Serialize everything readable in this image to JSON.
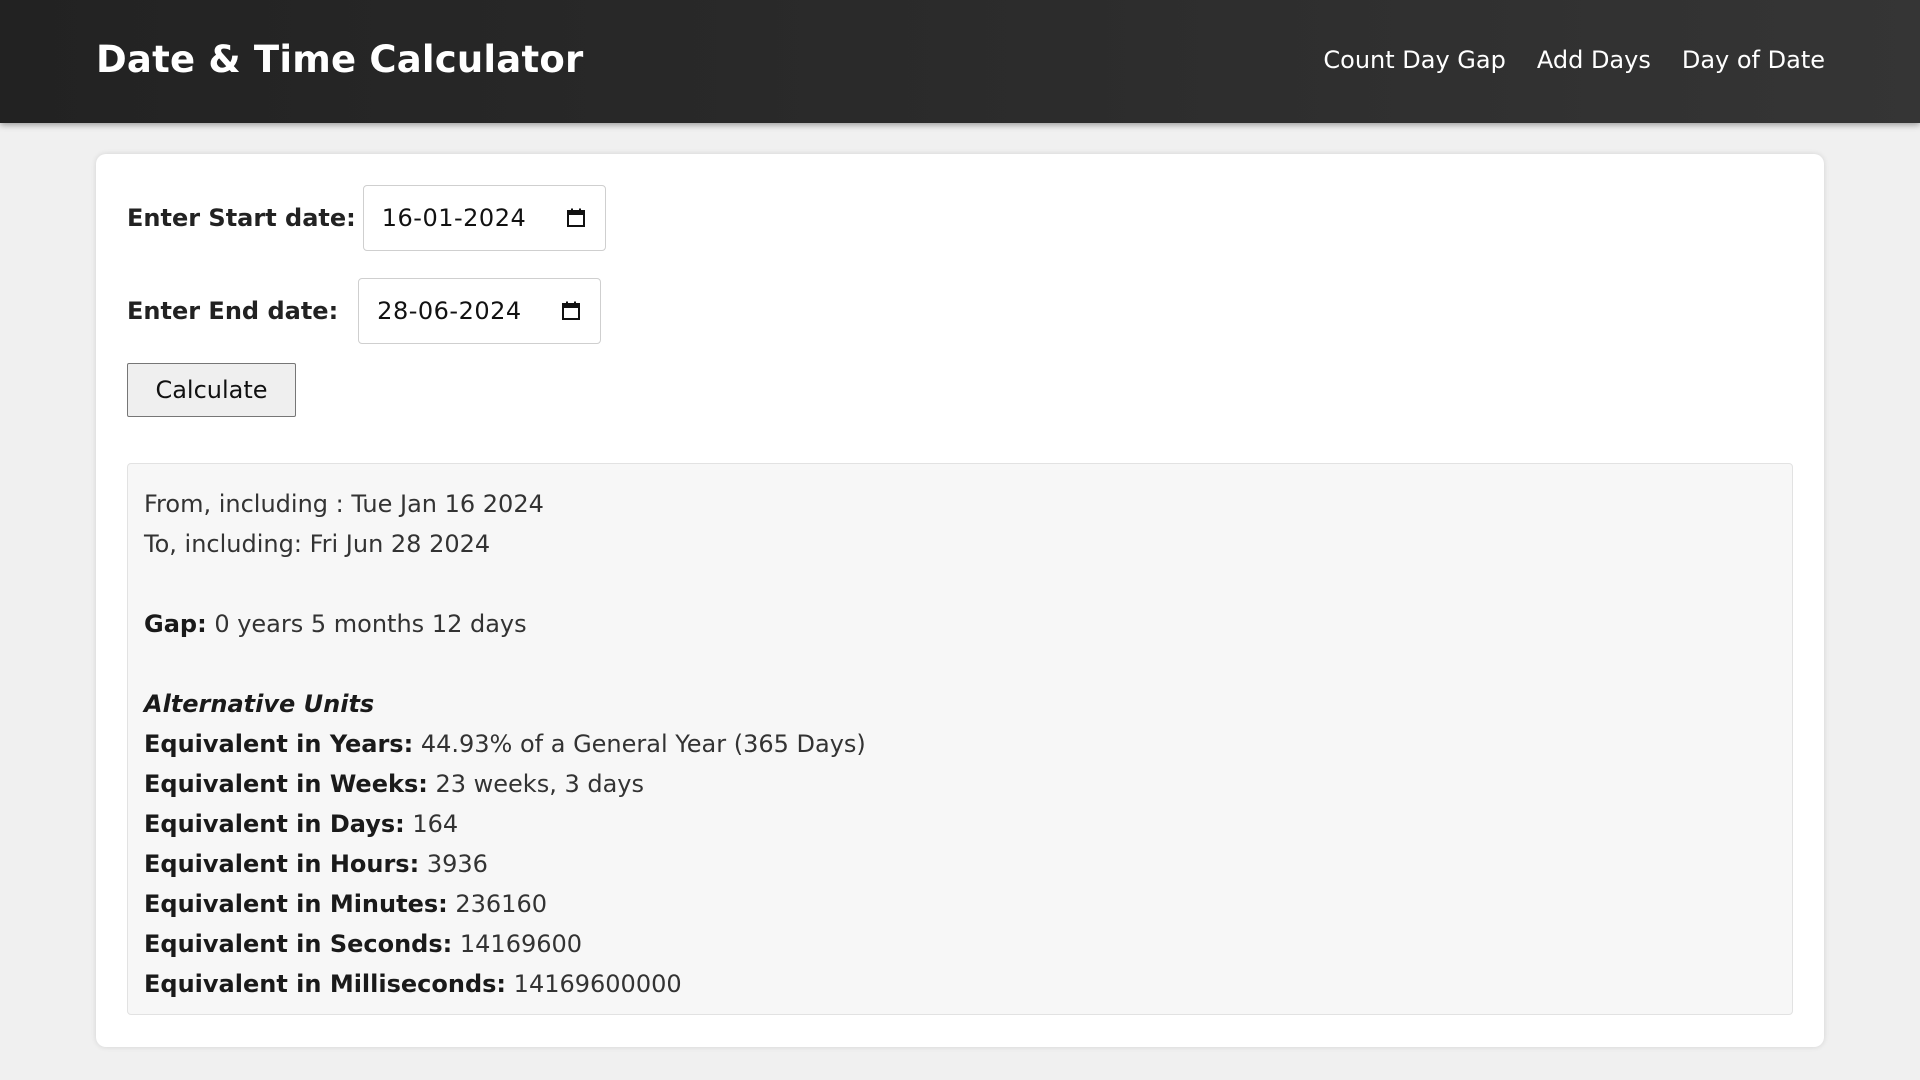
{
  "header": {
    "title": "Date & Time Calculator",
    "nav": [
      "Count Day Gap",
      "Add Days",
      "Day of Date"
    ]
  },
  "form": {
    "start_label": "Enter Start date:",
    "start_value": "16-01-2024",
    "end_label": "Enter End date:",
    "end_value": "28-06-2024",
    "calculate_label": "Calculate"
  },
  "result": {
    "from_label": "From, including :",
    "from_value": "Tue Jan 16 2024",
    "to_label": "To, including:",
    "to_value": "Fri Jun 28 2024",
    "gap_label": "Gap:",
    "gap_value": "0 years 5 months 12 days",
    "alt_heading": "Alternative Units",
    "units": [
      {
        "label": "Equivalent in Years:",
        "value": "44.93% of a General Year (365 Days)"
      },
      {
        "label": "Equivalent in Weeks:",
        "value": "23 weeks, 3 days"
      },
      {
        "label": "Equivalent in Days:",
        "value": "164"
      },
      {
        "label": "Equivalent in Hours:",
        "value": "3936"
      },
      {
        "label": "Equivalent in Minutes:",
        "value": "236160"
      },
      {
        "label": "Equivalent in Seconds:",
        "value": "14169600"
      },
      {
        "label": "Equivalent in Milliseconds:",
        "value": "14169600000"
      }
    ]
  },
  "icons": {
    "calendar": "calendar-icon"
  },
  "colors": {
    "header_bg": "#222222",
    "page_bg": "#f0f0f0",
    "card_bg": "#ffffff",
    "results_bg": "#f7f7f7"
  }
}
